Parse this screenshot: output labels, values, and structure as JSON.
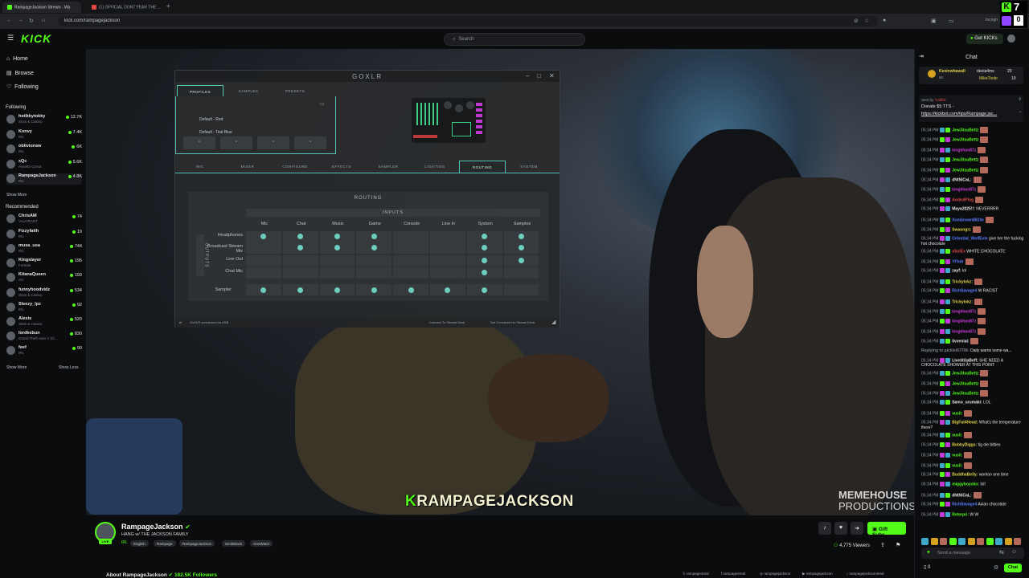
{
  "browser": {
    "tabs": [
      {
        "label": "RampageJackson Stream - Wa"
      },
      {
        "label": "(1) OFFICIAL DONT FEAR THE ..."
      }
    ],
    "url": "kick.com/rampagejackson",
    "ext_badge": "Incogn"
  },
  "header": {
    "logo": "KICK",
    "search_placeholder": "Search",
    "get_kicks": "Get KICKs"
  },
  "sidebar": {
    "nav": [
      {
        "label": "Home",
        "icon": "home-icon"
      },
      {
        "label": "Browse",
        "icon": "browse-icon"
      },
      {
        "label": "Following",
        "icon": "heart-icon"
      }
    ],
    "following_title": "Following",
    "following": [
      {
        "name": "hstikkytokky",
        "cat": "Slots & Casino",
        "viewers": "12.7K"
      },
      {
        "name": "Konvy",
        "cat": "IRL",
        "viewers": "7.4K"
      },
      {
        "name": "oblivionsw",
        "cat": "IRL",
        "viewers": "6K"
      },
      {
        "name": "xQc",
        "cat": "Assetto Corsa",
        "viewers": "5.6K"
      },
      {
        "name": "RampageJackson",
        "cat": "IRL",
        "viewers": "4.8K"
      }
    ],
    "show_more_1": "Show More",
    "recommended_title": "Recommended",
    "recommended": [
      {
        "name": "ChrisAM",
        "cat": "VALORANT",
        "viewers": "74"
      },
      {
        "name": "Fizzyfaith",
        "cat": "IRL",
        "viewers": "19"
      },
      {
        "name": "musa_usa",
        "cat": "IRL",
        "viewers": "744"
      },
      {
        "name": "Kingslayer",
        "cat": "Fortnite",
        "viewers": "195"
      },
      {
        "name": "KitanaQueen",
        "cat": "Art",
        "viewers": "193"
      },
      {
        "name": "funnyhoodvidz",
        "cat": "Slots & Casino",
        "viewers": "534"
      },
      {
        "name": "Sleezy_lpz",
        "cat": "IRL",
        "viewers": "92"
      },
      {
        "name": "Alexis",
        "cat": "Slots & Casino",
        "viewers": "520"
      },
      {
        "name": "lordkebun",
        "cat": "Grand Theft Auto V (G...",
        "viewers": "830"
      },
      {
        "name": "feef",
        "cat": "IRL",
        "viewers": "90"
      }
    ],
    "show_more_2": "Show More",
    "show_less": "Show Less"
  },
  "video": {
    "overlay_k": "K",
    "overlay_text": "RAMPAGEJACKSON",
    "watermark_1": "MEMEHOUSE",
    "watermark_2": "PRODUCTIONS"
  },
  "goxlr": {
    "title": "GOXLR",
    "top_tabs": [
      "PROFILES",
      "SAMPLES",
      "PRESETS"
    ],
    "profiles": [
      "Default - Red",
      "Default - Teal Blue"
    ],
    "main_tabs": [
      "MIC",
      "MIXER",
      "CONFIGURE",
      "EFFECTS",
      "SAMPLER",
      "LIGHTING",
      "ROUTING",
      "SYSTEM"
    ],
    "selected_tab": "ROUTING",
    "routing_title": "ROUTING",
    "inputs_label": "INPUTS",
    "outputs_label": "OUTPUTS",
    "columns": [
      "Mic",
      "Chat",
      "Music",
      "Game",
      "Console",
      "Line In",
      "System",
      "Samples"
    ],
    "rows": [
      {
        "label": "Headphones",
        "checks": [
          1,
          1,
          1,
          1,
          0,
          0,
          1,
          1
        ]
      },
      {
        "label": "Broadcast Stream Mix",
        "checks": [
          0,
          1,
          1,
          1,
          0,
          0,
          1,
          1
        ]
      },
      {
        "label": "Line Out",
        "checks": [
          0,
          0,
          0,
          0,
          0,
          0,
          1,
          1
        ]
      },
      {
        "label": "Chat Mic",
        "checks": [
          0,
          0,
          0,
          0,
          0,
          0,
          1,
          0
        ]
      }
    ],
    "sampler_row": {
      "label": "Sampler",
      "checks": [
        1,
        1,
        1,
        1,
        1,
        1,
        1,
        0
      ]
    },
    "status_left": "GoXLR connected via USB",
    "status_mid": "Connect To Stream Deck",
    "status_right": "Not Connected to Stream Deck"
  },
  "stream": {
    "name": "RampageJackson",
    "title": "HANG w/ THE JACKSON FAMILY",
    "live": "LIVE",
    "tags": [
      "IRL",
      "English",
      "Rampage",
      "RampageJackson",
      "SmileBack",
      "OneWater"
    ],
    "gift_subs": "Gift Subs",
    "viewers": "4,775 Viewers",
    "about": "About RampageJackson",
    "followers": "182.5K Followers",
    "socials": [
      "rampage4real",
      "rampage4real",
      "rampagejackson",
      "rampagejackson",
      "rampagejackson4real"
    ]
  },
  "chat": {
    "title": "Chat",
    "pinned": [
      {
        "name": "Kevinwhawall",
        "sub": "50"
      },
      {
        "name": "deela4me",
        "sub": "20"
      },
      {
        "name": "MikeTiede",
        "sub": "10"
      }
    ],
    "sent_by": "Sent by",
    "sent_by_user": "Trailblz",
    "donate_line": "Donate $5 TTS -",
    "donate_link": "https://kickbot.com/tips/Rampage.jac...",
    "messages": [
      {
        "t": "05:34 PM",
        "u": "JewJitsuBettz",
        "c": "#53fc18",
        "m": ""
      },
      {
        "t": "05:34 PM",
        "u": "JewJitsuBettz",
        "c": "#53fc18",
        "m": ""
      },
      {
        "t": "05:34 PM",
        "u": "kingkhan87z",
        "c": "#c23bd4",
        "m": ""
      },
      {
        "t": "05:34 PM",
        "u": "JewJitsuBettz",
        "c": "#53fc18",
        "m": ""
      },
      {
        "t": "05:34 PM",
        "u": "JewJitsuBettz",
        "c": "#53fc18",
        "m": ""
      },
      {
        "t": "05:34 PM",
        "u": "dNtNiCaL:",
        "c": "#e6e7e9",
        "m": ""
      },
      {
        "t": "05:34 PM",
        "u": "kingkhan87z",
        "c": "#c23bd4",
        "m": ""
      },
      {
        "t": "05:34 PM",
        "u": "AndrolPlug",
        "c": "#e04848",
        "m": ""
      },
      {
        "t": "05:34 PM",
        "u": "Maya2025!!:",
        "c": "#e6e7e9",
        "m": "NEVERRRR"
      },
      {
        "t": "05:34 PM",
        "u": "Xumbrown8824x",
        "c": "#5a7cff",
        "m": ""
      },
      {
        "t": "05:34 PM",
        "u": "Swaongrz",
        "c": "#e0d248",
        "m": ""
      },
      {
        "t": "05:34 PM",
        "u": "Celestial_WolfEvie",
        "c": "#5a7cff",
        "m": "give her the fucking hot chocolate"
      },
      {
        "t": "05:34 PM",
        "u": "xSolEx",
        "c": "#e04848",
        "m": "WHITE CHOCOLATE"
      },
      {
        "t": "05:34 PM",
        "u": "YFhdr",
        "c": "#5a7cff",
        "m": ""
      },
      {
        "t": "05:34 PM",
        "u": "zayf:",
        "c": "#e6e7e9",
        "m": "lol"
      },
      {
        "t": "05:34 PM",
        "u": "Trickylokz:",
        "c": "#e0d248",
        "m": ""
      },
      {
        "t": "05:34 PM",
        "u": "RichSavage4",
        "c": "#5a7cff",
        "m": "W RACIST"
      },
      {
        "t": "05:34 PM",
        "u": "Trickylokz:",
        "c": "#e0d248",
        "m": ""
      },
      {
        "t": "05:34 PM",
        "u": "kingkhan87z",
        "c": "#c23bd4",
        "m": ""
      },
      {
        "t": "05:34 PM",
        "u": "kingkhan87z",
        "c": "#c23bd4",
        "m": ""
      },
      {
        "t": "05:34 PM",
        "u": "kingkhan87z",
        "c": "#c23bd4",
        "m": ""
      },
      {
        "t": "05:34 PM",
        "u": "livvenial:",
        "c": "#e6e7e9",
        "m": ""
      },
      {
        "t": "",
        "u": "Replying to pickle/67706:",
        "c": "#7d8187",
        "m": "Daily warns some wa..."
      },
      {
        "t": "05:34 PM",
        "u": "LivelitUpBeff:",
        "c": "#e6e7e9",
        "m": "SHE NEED A CHOCOLATE SHOWER AT THIS POINT"
      },
      {
        "t": "05:34 PM",
        "u": "JewJitsuBettz",
        "c": "#53fc18",
        "m": ""
      },
      {
        "t": "05:34 PM",
        "u": "JewJitsuBettz",
        "c": "#53fc18",
        "m": ""
      },
      {
        "t": "05:34 PM",
        "u": "JewJitsuBettz",
        "c": "#53fc18",
        "m": ""
      },
      {
        "t": "05:34 PM",
        "u": "Samo_urumaki:",
        "c": "#e6e7e9",
        "m": "LOL"
      },
      {
        "t": "05:34 PM",
        "u": "vusli:",
        "c": "#53fc18",
        "m": ""
      },
      {
        "t": "05:34 PM",
        "u": "BigFat4Head:",
        "c": "#e0d248",
        "m": "What's the temperature there?"
      },
      {
        "t": "05:34 PM",
        "u": "vusli:",
        "c": "#53fc18",
        "m": ""
      },
      {
        "t": "05:34 PM",
        "u": "BobbyDiggs:",
        "c": "#e0d248",
        "m": "tig ole bitties"
      },
      {
        "t": "05:34 PM",
        "u": "vusli:",
        "c": "#53fc18",
        "m": ""
      },
      {
        "t": "05:34 PM",
        "u": "vusli:",
        "c": "#53fc18",
        "m": ""
      },
      {
        "t": "05:34 PM",
        "u": "BuddhaBelly:",
        "c": "#e0d248",
        "m": "wonton one time"
      },
      {
        "t": "05:34 PM",
        "u": "miggyboysko:",
        "c": "#53fc18",
        "m": "lol!"
      },
      {
        "t": "05:34 PM",
        "u": "dNtNiCaL:",
        "c": "#e6e7e9",
        "m": ""
      },
      {
        "t": "05:34 PM",
        "u": "RichSavage4",
        "c": "#5a7cff",
        "m": "Asian chocolate"
      },
      {
        "t": "05:34 PM",
        "u": "Reterpri:",
        "c": "#53fc18",
        "m": "W W"
      }
    ],
    "input_placeholder": "Send a message",
    "points": "0",
    "send_label": "Chat"
  },
  "corner_badge": "7",
  "corner_badge_2": "0"
}
